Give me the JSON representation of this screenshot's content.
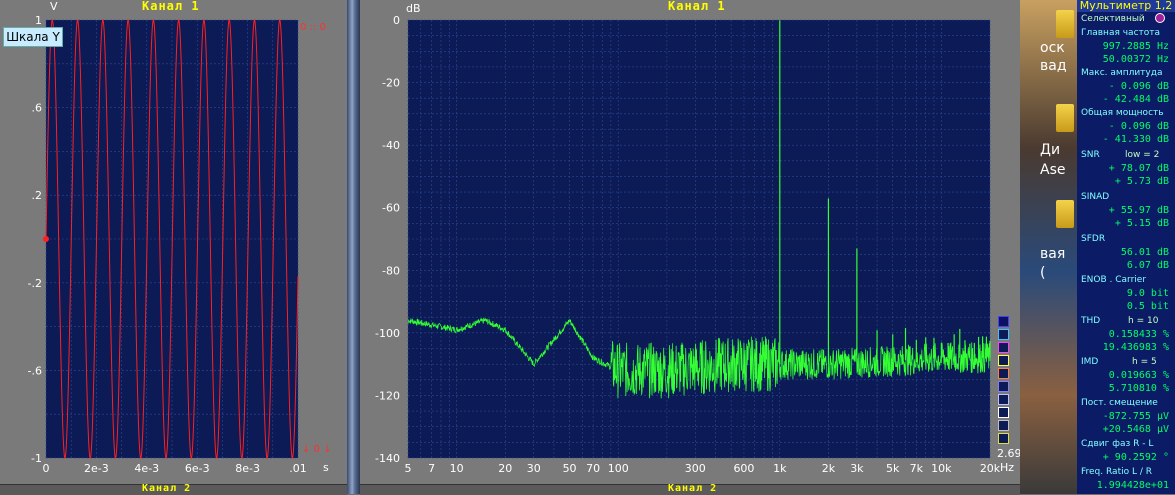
{
  "left_chart": {
    "title": "Канал 1",
    "y_unit": "V",
    "x_unit": "s",
    "scale_button": "Шкала Y",
    "y_ticks": [
      "1",
      ".6",
      ".2",
      "-.2",
      "-.6",
      "-1"
    ],
    "x_ticks": [
      "0",
      "2e-3",
      "4e-3",
      "6e-3",
      "8e-3",
      ".01"
    ],
    "marker_top": "0 :: 0",
    "marker_bottom": "↓ 0 ↓"
  },
  "mid_chart": {
    "title": "Канал 1",
    "y_unit": "dB",
    "x_unit": "Hz",
    "y_ticks": [
      "0",
      "-20",
      "-40",
      "-60",
      "-80",
      "-100",
      "-120",
      "-140"
    ],
    "x_ticks": [
      "5",
      "7",
      "10",
      "20",
      "30",
      "50",
      "70",
      "100",
      "300",
      "600",
      "1k",
      "2k",
      "3k",
      "5k",
      "7k",
      "10k",
      "20k"
    ],
    "corner_value": "2.691"
  },
  "bottom": {
    "left_title": "Канал 2",
    "mid_title": "Канал 2"
  },
  "desktop": {
    "t1": "оск",
    "t2": "вад",
    "t3": "Ди",
    "t4": "Ase",
    "t5": "вая",
    "t6": "("
  },
  "meter": {
    "title": "Мультиметр 1,2",
    "mode": "Селективный",
    "main_freq_label": "Главная частота",
    "main_freq_1": "997.2885 Hz",
    "main_freq_2": "50.00372 Hz",
    "max_amp_label": "Макс. амплитуда",
    "max_amp_1": "-  0.096 dB",
    "max_amp_2": "- 42.484 dB",
    "total_power_label": "Общая мощность",
    "total_power_1": "-  0.096 dB",
    "total_power_2": "- 41.330 dB",
    "snr_label": "SNR",
    "snr_low": "low = 2",
    "snr_1": "+ 78.07 dB",
    "snr_2": "+  5.73 dB",
    "sinad_label": "SINAD",
    "sinad_1": "+ 55.97 dB",
    "sinad_2": "+  5.15 dB",
    "sfdr_label": "SFDR",
    "sfdr_1": "56.01 dB",
    "sfdr_2": "6.07 dB",
    "enob_label": "ENOB . Carrier",
    "enob_1": "9.0 bit",
    "enob_2": "0.5 bit",
    "thd_label": "THD",
    "thd_h": "h = 10",
    "thd_1": "0.158433 %",
    "thd_2": "19.436983 %",
    "imd_label": "IMD",
    "imd_h": "h = 5",
    "imd_1": "0.019663 %",
    "imd_2": "5.710810 %",
    "dc_label": "Пост. смещение",
    "dc_1": "-872.755 µV",
    "dc_2": "+20.5468 µV",
    "phase_label": "Сдвиг фаз R - L",
    "phase_1": "+ 90.2592 °",
    "ratio_label": "Freq. Ratio  L / R",
    "ratio_1": "1.994428e+01"
  },
  "colors": {
    "plot_bg": "#0c1a55",
    "grid": "#2a4a9a",
    "wave": "#ff2020",
    "spectrum": "#33ff33",
    "tick_text": "#ffffff",
    "title": "#ffff00"
  },
  "chart_data": [
    {
      "type": "line",
      "title": "Канал 1",
      "xlabel": "s",
      "ylabel": "V",
      "xlim": [
        0,
        0.01
      ],
      "ylim": [
        -1,
        1
      ],
      "series": [
        {
          "frequency_hz": 997.2885,
          "amplitude": 1.0
        }
      ]
    },
    {
      "type": "line",
      "title": "Канал 1",
      "xlabel": "Hz",
      "ylabel": "dB",
      "x_scale": "log",
      "xlim": [
        5,
        20000
      ],
      "ylim": [
        -140,
        0
      ],
      "grid": true,
      "peaks": [
        {
          "x": 1000,
          "y": -0.1
        },
        {
          "x": 2000,
          "y": -57
        },
        {
          "x": 3000,
          "y": -73
        },
        {
          "x": 600,
          "y": -113
        },
        {
          "x": 300,
          "y": -110
        }
      ],
      "noise_floor": [
        {
          "x": 5,
          "y": -96
        },
        {
          "x": 10,
          "y": -99
        },
        {
          "x": 15,
          "y": -96
        },
        {
          "x": 20,
          "y": -99
        },
        {
          "x": 30,
          "y": -110
        },
        {
          "x": 50,
          "y": -96
        },
        {
          "x": 70,
          "y": -108
        },
        {
          "x": 100,
          "y": -112
        },
        {
          "x": 200,
          "y": -112
        },
        {
          "x": 500,
          "y": -110
        },
        {
          "x": 2000,
          "y": -110
        },
        {
          "x": 5000,
          "y": -109
        },
        {
          "x": 10000,
          "y": -108
        },
        {
          "x": 20000,
          "y": -108
        }
      ]
    }
  ]
}
